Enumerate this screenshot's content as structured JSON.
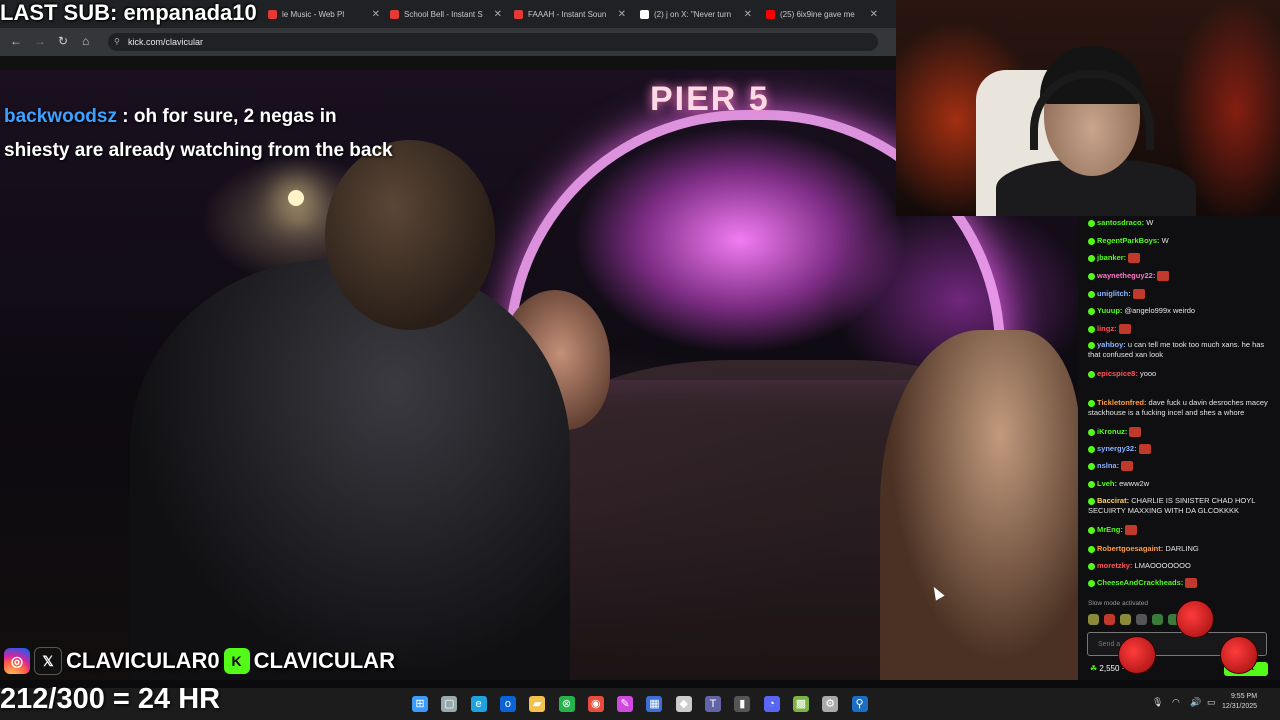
{
  "overlay": {
    "last_sub": "LAST SUB: empanada10",
    "chat_user": "backwoodsz",
    "chat_text": " : oh for sure, 2 negas in shiesty are already watching from the back",
    "social_handle_x": "CLAVICULAR0",
    "social_handle_kick": "CLAVICULAR",
    "sub_goal": "212/300 = 24 HR"
  },
  "browser": {
    "tabs": [
      {
        "label": "le Music - Web Pl",
        "color": "#e53935"
      },
      {
        "label": "School Bell - Instant S",
        "color": "#e53935"
      },
      {
        "label": "FAAAH - Instant Soun",
        "color": "#e53935"
      },
      {
        "label": "(2) j on X: \"Never turn",
        "color": "#ffffff"
      },
      {
        "label": "(25) 6ix9ine gave me",
        "color": "#ff0000"
      }
    ],
    "url": "kick.com/clavicular"
  },
  "video": {
    "sign_text": "PIER 5"
  },
  "chat": {
    "messages": [
      {
        "user": "santosdraco:",
        "text": " W",
        "color": "#53fc18"
      },
      {
        "user": "RegentParkBoys:",
        "text": " W",
        "color": "#53fc18"
      },
      {
        "user": "jbanker:",
        "text": "",
        "color": "#53fc18"
      },
      {
        "user": "waynetheguy22:",
        "text": "",
        "color": "#ff79c6"
      },
      {
        "user": "uniglitch:",
        "text": "",
        "color": "#8ab4ff"
      },
      {
        "user": "Yuuup:",
        "text": " @angelo999x weirdo",
        "color": "#53fc18"
      },
      {
        "user": "lingz:",
        "text": "",
        "color": "#ff5555"
      },
      {
        "user": "yahboy:",
        "text": " u can tell me took too much xans. he has that confused xan look",
        "color": "#8ab4ff"
      },
      {
        "user": "epicspice8:",
        "text": " yooo",
        "color": "#ff5555"
      },
      {
        "user": "Tickletonfred:",
        "text": " dave fuck u davin desroches macey stackhouse is a fucking incel and shes a whore",
        "color": "#ff9f43"
      },
      {
        "user": "iKronuz:",
        "text": "",
        "color": "#53fc18"
      },
      {
        "user": "synergy32:",
        "text": "",
        "color": "#8ab4ff"
      },
      {
        "user": "nslna:",
        "text": "",
        "color": "#8ab4ff"
      },
      {
        "user": "Lveh:",
        "text": " ewww2w",
        "color": "#53fc18"
      },
      {
        "user": "Baccirat:",
        "text": " CHARLIE IS SINISTER CHAD HOYL SECUIRTY MAXXING WITH DA GLCOKKKK",
        "color": "#ffd166"
      },
      {
        "user": "MrEng:",
        "text": "",
        "color": "#53fc18"
      },
      {
        "user": "Robertgoesagaint:",
        "text": " DARLING",
        "color": "#ff9f43"
      },
      {
        "user": "moretzky:",
        "text": " LMAOOOOOOO",
        "color": "#ff5555"
      },
      {
        "user": "CheeseAndCrackheads:",
        "text": "",
        "color": "#53fc18"
      }
    ],
    "slow_mode": "Slow mode activated",
    "input_placeholder": "Send a message",
    "points": "2,550",
    "points_extra": "0",
    "send_label": "Chat"
  },
  "taskbar": {
    "icons": [
      "windows-icon",
      "search-icon",
      "edge-icon",
      "outlook-icon",
      "folder-icon",
      "xbox-icon",
      "chrome-icon",
      "paint-icon",
      "store-icon",
      "map-icon",
      "teams-icon",
      "terminal-icon",
      "discord-icon",
      "minecraft-icon",
      "settings-icon",
      "steam-icon"
    ],
    "time": "9:55 PM",
    "date": "12/31/2025"
  }
}
